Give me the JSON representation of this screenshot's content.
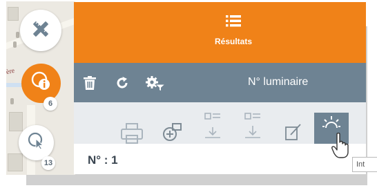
{
  "header": {
    "tab_label": "Résultats",
    "tab_icon": "list-icon",
    "accent_color": "#f08218"
  },
  "toolbar": {
    "title": "N° luminaire",
    "icons": [
      "trash-icon",
      "refresh-icon",
      "filter-settings-icon"
    ],
    "bg_color": "#6e8393"
  },
  "map_tools": {
    "tools_icon": "pencil-ruler-icon",
    "info_icon": "info-select-icon",
    "info_count": "6",
    "select_icon": "pointer-select-icon",
    "select_count": "13"
  },
  "actions": {
    "icons": [
      "print-icon",
      "locate-icon",
      "import-icon",
      "export-icon",
      "edit-icon",
      "luminaire-icon"
    ],
    "active": "luminaire-icon"
  },
  "detail": {
    "number_label": "N° : 1"
  },
  "tooltip": {
    "text": "Int"
  }
}
